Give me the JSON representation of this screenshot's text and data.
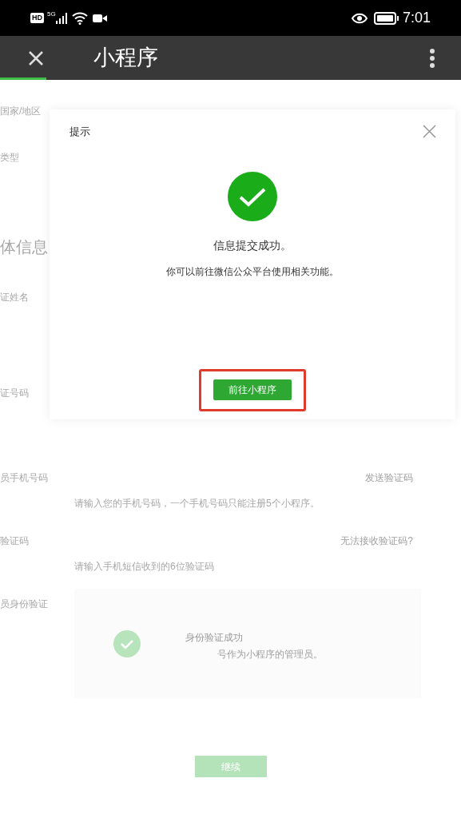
{
  "status_bar": {
    "hd_badge": "HD",
    "network": "5G",
    "time": "7:01"
  },
  "title_bar": {
    "title": "小程序",
    "load_progress": {
      "level": 0.1
    }
  },
  "form": {
    "rows": [
      {
        "kind": "field",
        "label": "国家/地区"
      },
      {
        "kind": "field",
        "label": "类型"
      },
      {
        "kind": "section",
        "label": "体信息"
      },
      {
        "kind": "field",
        "label": "证姓名"
      },
      {
        "kind": "field",
        "label": "证号码"
      },
      {
        "kind": "input",
        "label": "员手机号码",
        "action": "发送验证码",
        "placeholder": "请输入您的手机号码，一个手机号码只能注册5个小程序。"
      },
      {
        "kind": "input",
        "label": "验证码",
        "action": "无法接收验证码?",
        "placeholder": "请输入手机短信收到的6位验证码"
      },
      {
        "kind": "verify",
        "label": "员身份验证",
        "status": "身份验证成功",
        "note": "号作为小程序的管理员。"
      }
    ],
    "continue_button": {
      "label": "继续",
      "disabled": true
    }
  },
  "dialog": {
    "title": "提示",
    "message": "信息提交成功。",
    "detail": "你可以前往微信公众平台使用相关功能。",
    "button": {
      "label": "前往小程序",
      "highlighted": true
    }
  }
}
